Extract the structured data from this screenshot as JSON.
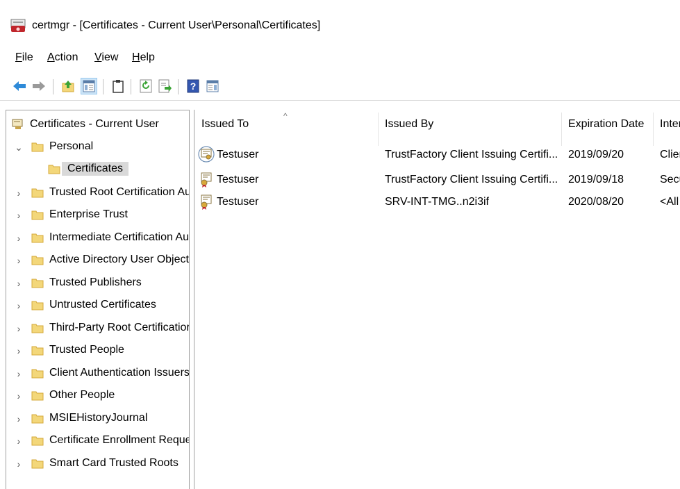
{
  "window": {
    "title": "certmgr - [Certificates - Current User\\Personal\\Certificates]"
  },
  "menu": [
    {
      "label": "File",
      "key": "F",
      "rest": "ile"
    },
    {
      "label": "Action",
      "key": "A",
      "rest": "ction"
    },
    {
      "label": "View",
      "key": "V",
      "rest": "iew"
    },
    {
      "label": "Help",
      "key": "H",
      "rest": "elp"
    }
  ],
  "toolbar": [
    "back-icon",
    "forward-icon",
    "up-folder-icon",
    "show-hide-console-tree-icon",
    "clipboard-icon",
    "refresh-icon",
    "export-list-icon",
    "help-icon",
    "show-hide-action-pane-icon"
  ],
  "tree": {
    "root": "Certificates - Current User",
    "items": [
      {
        "label": "Personal",
        "expanded": true
      },
      {
        "label": "Certificates",
        "selected": true
      },
      {
        "label": "Trusted Root Certification Au"
      },
      {
        "label": "Enterprise Trust"
      },
      {
        "label": "Intermediate Certification Au"
      },
      {
        "label": "Active Directory User Object"
      },
      {
        "label": "Trusted Publishers"
      },
      {
        "label": "Untrusted Certificates"
      },
      {
        "label": "Third-Party Root Certificatior"
      },
      {
        "label": "Trusted People"
      },
      {
        "label": "Client Authentication Issuers"
      },
      {
        "label": "Other People"
      },
      {
        "label": "MSIEHistoryJournal"
      },
      {
        "label": "Certificate Enrollment Reque:"
      },
      {
        "label": "Smart Card Trusted Roots"
      }
    ]
  },
  "list": {
    "columns": [
      "Issued To",
      "Issued By",
      "Expiration Date",
      "Inter"
    ],
    "sort_indicator": "^",
    "rows": [
      {
        "issued_to": "Testuser",
        "issued_by": "TrustFactory Client Issuing Certifi...",
        "expiration": "2019/09/20",
        "intended": "Clier"
      },
      {
        "issued_to": "Testuser",
        "issued_by": "TrustFactory Client Issuing Certifi...",
        "expiration": "2019/09/18",
        "intended": "Secu"
      },
      {
        "issued_to": "Testuser",
        "issued_by": "SRV-INT-TMG..n2i3if",
        "expiration": "2020/08/20",
        "intended": "<All"
      }
    ]
  },
  "colors": {
    "folder": "#f3d77a",
    "folder_edge": "#d4a93a",
    "selection": "#d9d9d9",
    "toolbar_active": "#cce4f7",
    "arrow_blue": "#2e8ad8"
  }
}
